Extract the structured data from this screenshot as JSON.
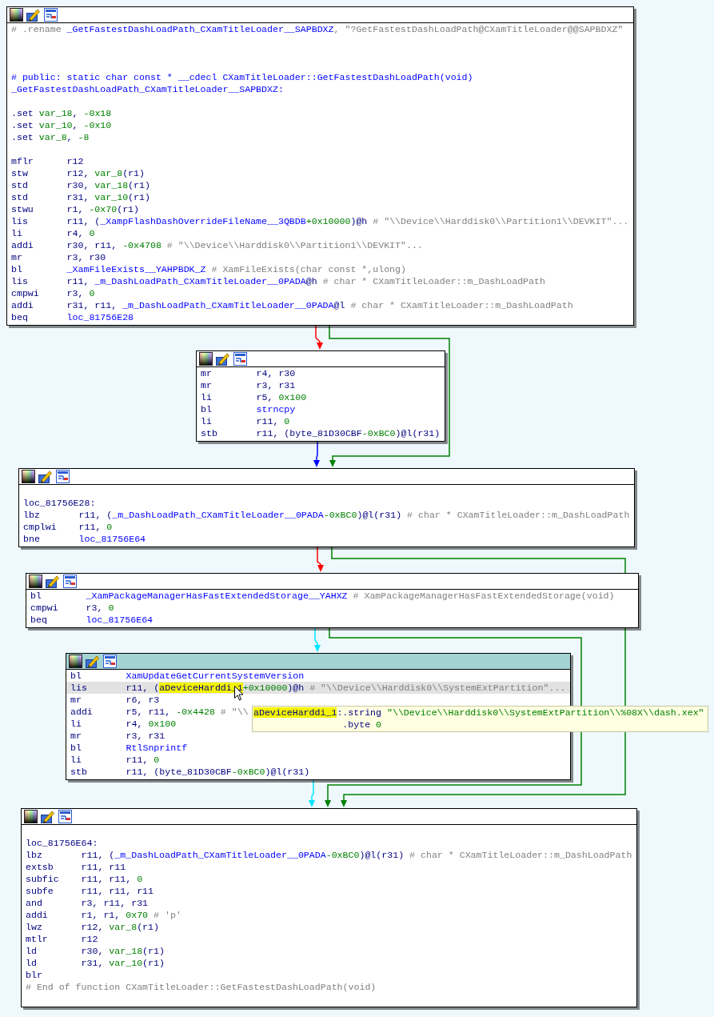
{
  "blocks": [
    {
      "selected": false,
      "lines": [
        {
          "kind": "text",
          "selected": false,
          "parts": [
            {
              "kind": "comment",
              "text": "# .rename "
            },
            {
              "kind": "symbol",
              "text": "_GetFastestDashLoadPath_CXamTitleLoader__SAPBDXZ"
            },
            {
              "kind": "quoted",
              "text": ", \"?GetFastestDashLoadPath@CXamTitleLoader@@SAPBDXZ\""
            }
          ]
        },
        {
          "kind": "blank"
        },
        {
          "kind": "blank"
        },
        {
          "kind": "blank"
        },
        {
          "kind": "text",
          "selected": false,
          "parts": [
            {
              "kind": "symbol",
              "text": "# public: static char const * __cdecl CXamTitleLoader::GetFastestDashLoadPath(void)"
            }
          ]
        },
        {
          "kind": "text",
          "selected": false,
          "parts": [
            {
              "kind": "symbol",
              "text": "_GetFastestDashLoadPath_CXamTitleLoader__SAPBDXZ:"
            }
          ]
        },
        {
          "kind": "blank"
        },
        {
          "kind": "text",
          "selected": false,
          "parts": [
            {
              "kind": "plain",
              "text": ".set "
            },
            {
              "kind": "variable",
              "text": "var_18"
            },
            {
              "kind": "plain",
              "text": ", "
            },
            {
              "kind": "number",
              "text": "-0x18"
            }
          ]
        },
        {
          "kind": "text",
          "selected": false,
          "parts": [
            {
              "kind": "plain",
              "text": ".set "
            },
            {
              "kind": "variable",
              "text": "var_10"
            },
            {
              "kind": "plain",
              "text": ", "
            },
            {
              "kind": "number",
              "text": "-0x10"
            }
          ]
        },
        {
          "kind": "text",
          "selected": false,
          "parts": [
            {
              "kind": "plain",
              "text": ".set "
            },
            {
              "kind": "variable",
              "text": "var_8"
            },
            {
              "kind": "plain",
              "text": ", "
            },
            {
              "kind": "number",
              "text": "-8"
            }
          ]
        },
        {
          "kind": "blank"
        },
        {
          "kind": "insn",
          "selected": false,
          "mnemonic": "mflr",
          "parts": [
            {
              "kind": "plain",
              "text": "r12"
            }
          ]
        },
        {
          "kind": "insn",
          "selected": false,
          "mnemonic": "stw",
          "parts": [
            {
              "kind": "plain",
              "text": "r12, "
            },
            {
              "kind": "variable",
              "text": "var_8"
            },
            {
              "kind": "plain",
              "text": "(r1)"
            }
          ]
        },
        {
          "kind": "insn",
          "selected": false,
          "mnemonic": "std",
          "parts": [
            {
              "kind": "plain",
              "text": "r30, "
            },
            {
              "kind": "variable",
              "text": "var_18"
            },
            {
              "kind": "plain",
              "text": "(r1)"
            }
          ]
        },
        {
          "kind": "insn",
          "selected": false,
          "mnemonic": "std",
          "parts": [
            {
              "kind": "plain",
              "text": "r31, "
            },
            {
              "kind": "variable",
              "text": "var_10"
            },
            {
              "kind": "plain",
              "text": "(r1)"
            }
          ]
        },
        {
          "kind": "insn",
          "selected": false,
          "mnemonic": "stwu",
          "parts": [
            {
              "kind": "plain",
              "text": "r1, "
            },
            {
              "kind": "number",
              "text": "-0x70"
            },
            {
              "kind": "plain",
              "text": "(r1)"
            }
          ]
        },
        {
          "kind": "insn",
          "selected": false,
          "mnemonic": "lis",
          "parts": [
            {
              "kind": "plain",
              "text": "r11, ("
            },
            {
              "kind": "symbol",
              "text": "_XampFlashDashOverrideFileName__3QBDB"
            },
            {
              "kind": "number",
              "text": "+0x10000"
            },
            {
              "kind": "plain",
              "text": ")@h "
            },
            {
              "kind": "comment",
              "text": "# \"\\\\Device\\\\Harddisk0\\\\Partition1\\\\DEVKIT\"..."
            }
          ]
        },
        {
          "kind": "insn",
          "selected": false,
          "mnemonic": "li",
          "parts": [
            {
              "kind": "plain",
              "text": "r4, "
            },
            {
              "kind": "number",
              "text": "0"
            }
          ]
        },
        {
          "kind": "insn",
          "selected": false,
          "mnemonic": "addi",
          "parts": [
            {
              "kind": "plain",
              "text": "r30, r11, "
            },
            {
              "kind": "number",
              "text": "-0x4708"
            },
            {
              "kind": "comment",
              "text": "# \"\\\\Device\\\\Harddisk0\\\\Partition1\\\\DEVKIT\"..."
            }
          ]
        },
        {
          "kind": "insn",
          "selected": false,
          "mnemonic": "mr",
          "parts": [
            {
              "kind": "plain",
              "text": "r3, r30"
            }
          ]
        },
        {
          "kind": "insn",
          "selected": false,
          "mnemonic": "bl",
          "parts": [
            {
              "kind": "symbol",
              "text": "_XamFileExists__YAHPBDK_Z"
            },
            {
              "kind": "comment",
              "text": "# XamFileExists(char const *,ulong)"
            }
          ]
        },
        {
          "kind": "insn",
          "selected": false,
          "mnemonic": "lis",
          "parts": [
            {
              "kind": "plain",
              "text": "r11, "
            },
            {
              "kind": "symbol",
              "text": "_m_DashLoadPath_CXamTitleLoader__0PADA"
            },
            {
              "kind": "plain",
              "text": "@h "
            },
            {
              "kind": "comment",
              "text": "# char * CXamTitleLoader::m_DashLoadPath"
            }
          ]
        },
        {
          "kind": "insn",
          "selected": false,
          "mnemonic": "cmpwi",
          "parts": [
            {
              "kind": "plain",
              "text": "r3, "
            },
            {
              "kind": "number",
              "text": "0"
            }
          ]
        },
        {
          "kind": "insn",
          "selected": false,
          "mnemonic": "addi",
          "parts": [
            {
              "kind": "plain",
              "text": "r31, r11, "
            },
            {
              "kind": "symbol",
              "text": "_m_DashLoadPath_CXamTitleLoader__0PADA"
            },
            {
              "kind": "plain",
              "text": "@l "
            },
            {
              "kind": "comment",
              "text": "# char * CXamTitleLoader::m_DashLoadPath"
            }
          ]
        },
        {
          "kind": "insn",
          "selected": false,
          "mnemonic": "beq",
          "parts": [
            {
              "kind": "symbol",
              "text": "loc_81756E28"
            }
          ]
        }
      ]
    },
    {
      "selected": false,
      "lines": [
        {
          "kind": "insn",
          "selected": false,
          "mnemonic": "mr",
          "parts": [
            {
              "kind": "plain",
              "text": "r4, r30"
            }
          ]
        },
        {
          "kind": "insn",
          "selected": false,
          "mnemonic": "mr",
          "parts": [
            {
              "kind": "plain",
              "text": "r3, r31"
            }
          ]
        },
        {
          "kind": "insn",
          "selected": false,
          "mnemonic": "li",
          "parts": [
            {
              "kind": "plain",
              "text": "r5, "
            },
            {
              "kind": "number",
              "text": "0x100"
            }
          ]
        },
        {
          "kind": "insn",
          "selected": false,
          "mnemonic": "bl",
          "parts": [
            {
              "kind": "symbol",
              "text": "strncpy"
            }
          ]
        },
        {
          "kind": "insn",
          "selected": false,
          "mnemonic": "li",
          "parts": [
            {
              "kind": "plain",
              "text": "r11, "
            },
            {
              "kind": "number",
              "text": "0"
            }
          ]
        },
        {
          "kind": "insn",
          "selected": false,
          "mnemonic": "stb",
          "parts": [
            {
              "kind": "plain",
              "text": "r11, (byte_81D30CBF"
            },
            {
              "kind": "number",
              "text": "-0xBC0"
            },
            {
              "kind": "plain",
              "text": ")@l(r31)"
            }
          ]
        }
      ]
    },
    {
      "selected": false,
      "lines": [
        {
          "kind": "blank"
        },
        {
          "kind": "text",
          "selected": false,
          "parts": [
            {
              "kind": "plain",
              "text": "loc_81756E28:"
            }
          ]
        },
        {
          "kind": "insn",
          "selected": false,
          "mnemonic": "lbz",
          "parts": [
            {
              "kind": "plain",
              "text": "r11, ("
            },
            {
              "kind": "symbol",
              "text": "_m_DashLoadPath_CXamTitleLoader__0PADA"
            },
            {
              "kind": "number",
              "text": "-0xBC0"
            },
            {
              "kind": "plain",
              "text": ")@l(r31) "
            },
            {
              "kind": "comment",
              "text": "# char * CXamTitleLoader::m_DashLoadPath"
            }
          ]
        },
        {
          "kind": "insn",
          "selected": false,
          "mnemonic": "cmplwi",
          "parts": [
            {
              "kind": "plain",
              "text": "r11, "
            },
            {
              "kind": "number",
              "text": "0"
            }
          ]
        },
        {
          "kind": "insn",
          "selected": false,
          "mnemonic": "bne",
          "parts": [
            {
              "kind": "symbol",
              "text": "loc_81756E64"
            }
          ]
        }
      ]
    },
    {
      "selected": false,
      "lines": [
        {
          "kind": "insn",
          "selected": false,
          "mnemonic": "bl",
          "parts": [
            {
              "kind": "symbol",
              "text": "_XamPackageManagerHasFastExtendedStorage__YAHXZ"
            },
            {
              "kind": "comment",
              "text": "# XamPackageManagerHasFastExtendedStorage(void)"
            }
          ]
        },
        {
          "kind": "insn",
          "selected": false,
          "mnemonic": "cmpwi",
          "parts": [
            {
              "kind": "plain",
              "text": "r3, "
            },
            {
              "kind": "number",
              "text": "0"
            }
          ]
        },
        {
          "kind": "insn",
          "selected": false,
          "mnemonic": "beq",
          "parts": [
            {
              "kind": "symbol",
              "text": "loc_81756E64"
            }
          ]
        }
      ]
    },
    {
      "selected": true,
      "lines": [
        {
          "kind": "insn",
          "selected": false,
          "mnemonic": "bl",
          "parts": [
            {
              "kind": "symbol",
              "text": "XamUpdateGetCurrentSystemVersion"
            }
          ]
        },
        {
          "kind": "insn",
          "selected": true,
          "mnemonic": "lis",
          "parts": [
            {
              "kind": "plain",
              "text": "r11, ("
            },
            {
              "kind": "highlight",
              "text": "aDeviceHarddi_1"
            },
            {
              "kind": "number",
              "text": "+0x10000"
            },
            {
              "kind": "plain",
              "text": ")@h "
            },
            {
              "kind": "comment",
              "text": "# \"\\\\Device\\\\Harddisk0\\\\SystemExtPartition\"..."
            }
          ]
        },
        {
          "kind": "insn",
          "selected": false,
          "mnemonic": "mr",
          "parts": [
            {
              "kind": "plain",
              "text": "r6, r3"
            }
          ]
        },
        {
          "kind": "insn",
          "selected": false,
          "mnemonic": "addi",
          "parts": [
            {
              "kind": "plain",
              "text": "r5, r11, "
            },
            {
              "kind": "number",
              "text": "-0x4428"
            },
            {
              "kind": "comment",
              "text": "# \"\\\\"
            }
          ]
        },
        {
          "kind": "insn",
          "selected": false,
          "mnemonic": "li",
          "parts": [
            {
              "kind": "plain",
              "text": "r4, "
            },
            {
              "kind": "number",
              "text": "0x100"
            }
          ]
        },
        {
          "kind": "insn",
          "selected": false,
          "mnemonic": "mr",
          "parts": [
            {
              "kind": "plain",
              "text": "r3, r31"
            }
          ]
        },
        {
          "kind": "insn",
          "selected": false,
          "mnemonic": "bl",
          "parts": [
            {
              "kind": "symbol",
              "text": "RtlSnprintf"
            }
          ]
        },
        {
          "kind": "insn",
          "selected": false,
          "mnemonic": "li",
          "parts": [
            {
              "kind": "plain",
              "text": "r11, "
            },
            {
              "kind": "number",
              "text": "0"
            }
          ]
        },
        {
          "kind": "insn",
          "selected": false,
          "mnemonic": "stb",
          "parts": [
            {
              "kind": "plain",
              "text": "r11, (byte_81D30CBF"
            },
            {
              "kind": "number",
              "text": "-0xBC0"
            },
            {
              "kind": "plain",
              "text": ")@l(r31)"
            }
          ]
        }
      ]
    },
    {
      "selected": false,
      "lines": [
        {
          "kind": "blank"
        },
        {
          "kind": "text",
          "selected": false,
          "parts": [
            {
              "kind": "plain",
              "text": "loc_81756E64:"
            }
          ]
        },
        {
          "kind": "insn",
          "selected": false,
          "mnemonic": "lbz",
          "parts": [
            {
              "kind": "plain",
              "text": "r11, ("
            },
            {
              "kind": "symbol",
              "text": "_m_DashLoadPath_CXamTitleLoader__0PADA"
            },
            {
              "kind": "number",
              "text": "-0xBC0"
            },
            {
              "kind": "plain",
              "text": ")@l(r31) "
            },
            {
              "kind": "comment",
              "text": "# char * CXamTitleLoader::m_DashLoadPath"
            }
          ]
        },
        {
          "kind": "insn",
          "selected": false,
          "mnemonic": "extsb",
          "parts": [
            {
              "kind": "plain",
              "text": "r11, r11"
            }
          ]
        },
        {
          "kind": "insn",
          "selected": false,
          "mnemonic": "subfic",
          "parts": [
            {
              "kind": "plain",
              "text": "r11, r11, "
            },
            {
              "kind": "number",
              "text": "0"
            }
          ]
        },
        {
          "kind": "insn",
          "selected": false,
          "mnemonic": "subfe",
          "parts": [
            {
              "kind": "plain",
              "text": "r11, r11, r11"
            }
          ]
        },
        {
          "kind": "insn",
          "selected": false,
          "mnemonic": "and",
          "parts": [
            {
              "kind": "plain",
              "text": "r3, r11, r31"
            }
          ]
        },
        {
          "kind": "insn",
          "selected": false,
          "mnemonic": "addi",
          "parts": [
            {
              "kind": "plain",
              "text": "r1, r1, "
            },
            {
              "kind": "number",
              "text": "0x70"
            },
            {
              "kind": "comment",
              "text": "# 'p'"
            }
          ]
        },
        {
          "kind": "insn",
          "selected": false,
          "mnemonic": "lwz",
          "parts": [
            {
              "kind": "plain",
              "text": "r12, "
            },
            {
              "kind": "variable",
              "text": "var_8"
            },
            {
              "kind": "plain",
              "text": "(r1)"
            }
          ]
        },
        {
          "kind": "insn",
          "selected": false,
          "mnemonic": "mtlr",
          "parts": [
            {
              "kind": "plain",
              "text": "r12"
            }
          ]
        },
        {
          "kind": "insn",
          "selected": false,
          "mnemonic": "ld",
          "parts": [
            {
              "kind": "plain",
              "text": "r30, "
            },
            {
              "kind": "variable",
              "text": "var_18"
            },
            {
              "kind": "plain",
              "text": "(r1)"
            }
          ]
        },
        {
          "kind": "insn",
          "selected": false,
          "mnemonic": "ld",
          "parts": [
            {
              "kind": "plain",
              "text": "r31, "
            },
            {
              "kind": "variable",
              "text": "var_10"
            },
            {
              "kind": "plain",
              "text": "(r1)"
            }
          ]
        },
        {
          "kind": "insn",
          "selected": false,
          "mnemonic": "blr"
        },
        {
          "kind": "text",
          "selected": false,
          "parts": [
            {
              "kind": "comment",
              "text": "# End of function CXamTitleLoader::GetFastestDashLoadPath(void)"
            }
          ]
        },
        {
          "kind": "blank"
        }
      ]
    }
  ],
  "edges": [
    {
      "color": "#ff0000"
    },
    {
      "color": "#008000"
    },
    {
      "color": "#0000ff"
    },
    {
      "color": "#ff0000"
    },
    {
      "color": "#008000"
    },
    {
      "color": "#00e5ff"
    },
    {
      "color": "#008000"
    },
    {
      "color": "#00e5ff"
    }
  ],
  "tooltip": {
    "lines": [
      {
        "kind": "head",
        "parts": [
          {
            "kind": "highlight",
            "text": "aDeviceHarddi_1"
          },
          {
            "kind": "plain",
            "text": ":.string "
          },
          {
            "kind": "string",
            "text": "\"\\\\Device\\\\Harddisk0\\\\SystemExtPartition\\\\%08X\\\\dash.xex\""
          }
        ]
      },
      {
        "kind": "cont",
        "parts": [
          {
            "kind": "plain",
            "text": ".byte "
          },
          {
            "kind": "number",
            "text": "0"
          }
        ]
      }
    ]
  }
}
